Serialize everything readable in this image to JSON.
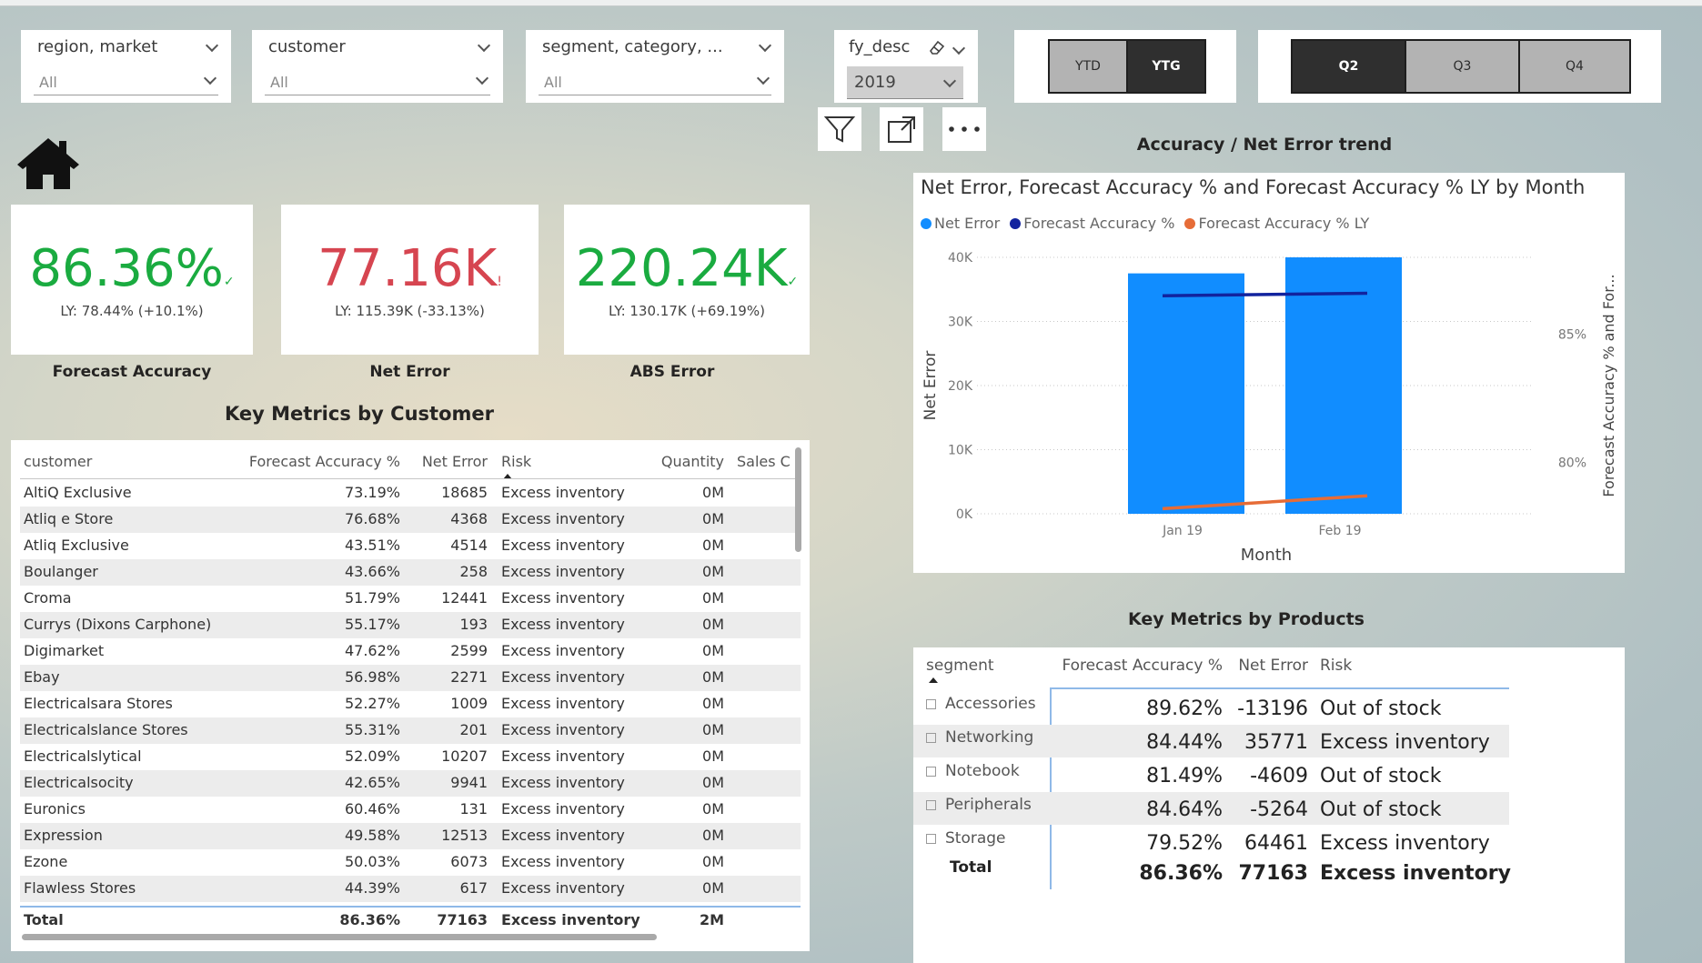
{
  "filters": {
    "region": {
      "title": "region, market",
      "value": "All"
    },
    "customer": {
      "title": "customer",
      "value": "All"
    },
    "segment": {
      "title": "segment, category, ...",
      "value": "All"
    },
    "fy": {
      "title": "fy_desc",
      "value": "2019"
    }
  },
  "period_toggle": {
    "ytd": "YTD",
    "ytg": "YTG",
    "selected": "YTG"
  },
  "quarter_toggle": {
    "q2": "Q2",
    "q3": "Q3",
    "q4": "Q4",
    "selected": "Q2"
  },
  "kpis": [
    {
      "value": "86.36%",
      "indicator": "✓",
      "ly": "LY: 78.44% (+10.1%)",
      "label": "Forecast Accuracy",
      "color": "#1aab40"
    },
    {
      "value": "77.16K",
      "indicator": "!",
      "ly": "LY: 115.39K (-33.13%)",
      "label": "Net Error",
      "color": "#d64550"
    },
    {
      "value": "220.24K",
      "indicator": "✓",
      "ly": "LY: 130.17K (+69.19%)",
      "label": "ABS Error",
      "color": "#1aab40"
    }
  ],
  "customer_table": {
    "title": "Key Metrics by Customer",
    "columns": [
      "customer",
      "Forecast Accuracy %",
      "Net Error",
      "Risk",
      "Quantity",
      "Sales C"
    ],
    "rows": [
      [
        "AltiQ Exclusive",
        "73.19%",
        "18685",
        "Excess inventory",
        "0M"
      ],
      [
        "Atliq e Store",
        "76.68%",
        "4368",
        "Excess inventory",
        "0M"
      ],
      [
        "Atliq Exclusive",
        "43.51%",
        "4514",
        "Excess inventory",
        "0M"
      ],
      [
        "Boulanger",
        "43.66%",
        "258",
        "Excess inventory",
        "0M"
      ],
      [
        "Croma",
        "51.79%",
        "12441",
        "Excess inventory",
        "0M"
      ],
      [
        "Currys (Dixons Carphone)",
        "55.17%",
        "193",
        "Excess inventory",
        "0M"
      ],
      [
        "Digimarket",
        "47.62%",
        "2599",
        "Excess inventory",
        "0M"
      ],
      [
        "Ebay",
        "56.98%",
        "2271",
        "Excess inventory",
        "0M"
      ],
      [
        "Electricalsara Stores",
        "52.27%",
        "1009",
        "Excess inventory",
        "0M"
      ],
      [
        "Electricalslance Stores",
        "55.31%",
        "201",
        "Excess inventory",
        "0M"
      ],
      [
        "Electricalslytical",
        "52.09%",
        "10207",
        "Excess inventory",
        "0M"
      ],
      [
        "Electricalsocity",
        "42.65%",
        "9941",
        "Excess inventory",
        "0M"
      ],
      [
        "Euronics",
        "60.46%",
        "131",
        "Excess inventory",
        "0M"
      ],
      [
        "Expression",
        "49.58%",
        "12513",
        "Excess inventory",
        "0M"
      ],
      [
        "Ezone",
        "50.03%",
        "6073",
        "Excess inventory",
        "0M"
      ],
      [
        "Flawless Stores",
        "44.39%",
        "617",
        "Excess inventory",
        "0M"
      ]
    ],
    "total": [
      "Total",
      "86.36%",
      "77163",
      "Excess inventory",
      "2M"
    ]
  },
  "trend": {
    "section_title": "Accuracy / Net Error trend",
    "chart_data": {
      "type": "bar",
      "title": "Net Error, Forecast Accuracy % and Forecast Accuracy % LY by Month",
      "categories": [
        "Jan 19",
        "Feb 19"
      ],
      "xlabel": "Month",
      "ylabel": "Net Error",
      "y2label": "Forecast Accuracy % and For...",
      "ylim": [
        0,
        40000
      ],
      "y_ticks": [
        "0K",
        "10K",
        "20K",
        "30K",
        "40K"
      ],
      "y2lim": [
        78,
        88
      ],
      "y2_ticks": [
        "80%",
        "85%"
      ],
      "series": [
        {
          "name": "Net Error",
          "kind": "bar",
          "axis": "y",
          "color": "#118dff",
          "values": [
            37500,
            40000
          ]
        },
        {
          "name": "Forecast Accuracy %",
          "kind": "line",
          "axis": "y2",
          "color": "#12239e",
          "values": [
            86.5,
            86.6
          ]
        },
        {
          "name": "Forecast Accuracy % LY",
          "kind": "line",
          "axis": "y2",
          "color": "#e66c37",
          "values": [
            78.2,
            78.7
          ]
        }
      ],
      "grid": true,
      "legend": "top-left"
    }
  },
  "product_table": {
    "title": "Key Metrics by Products",
    "columns": [
      "segment",
      "Forecast Accuracy %",
      "Net Error",
      "Risk"
    ],
    "rows": [
      [
        "Accessories",
        "89.62%",
        "-13196",
        "Out of stock"
      ],
      [
        "Networking",
        "84.44%",
        "35771",
        "Excess inventory"
      ],
      [
        "Notebook",
        "81.49%",
        "-4609",
        "Out of stock"
      ],
      [
        "Peripherals",
        "84.64%",
        "-5264",
        "Out of stock"
      ],
      [
        "Storage",
        "79.52%",
        "64461",
        "Excess inventory"
      ]
    ],
    "total": [
      "Total",
      "86.36%",
      "77163",
      "Excess inventory"
    ]
  },
  "icons": [
    "home-icon",
    "filter-icon",
    "focus-mode-icon",
    "more-options-icon",
    "eraser-icon",
    "chevron-down-icon"
  ]
}
